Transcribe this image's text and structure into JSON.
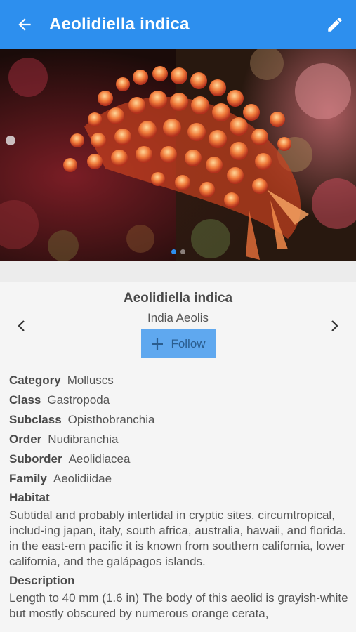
{
  "appbar": {
    "title": "Aeolidiella indica",
    "back_icon": "arrow-left-icon",
    "edit_icon": "pencil-icon",
    "color": "#2d8fee"
  },
  "gallery": {
    "image_label": "sea-slug-photo",
    "dots": 2,
    "active_dot": 0
  },
  "species": {
    "scientific_name": "Aeolidiella indica",
    "common_name": "India Aeolis",
    "follow_label": "Follow",
    "follow_icon": "plus-icon",
    "prev_icon": "chevron-left-icon",
    "next_icon": "chevron-right-icon"
  },
  "taxonomy": [
    {
      "key": "Category",
      "value": "Molluscs"
    },
    {
      "key": "Class",
      "value": "Gastropoda"
    },
    {
      "key": "Subclass",
      "value": "Opisthobranchia"
    },
    {
      "key": "Order",
      "value": "Nudibranchia"
    },
    {
      "key": "Suborder",
      "value": "Aeolidiacea"
    },
    {
      "key": "Family",
      "value": "Aeolidiidae"
    }
  ],
  "habitat": {
    "label": "Habitat",
    "text": "Subtidal and probably intertidal in cryptic sites. circumtropical, includ-ing japan, italy, south africa, australia, hawaii, and florida. in the east-ern pacific it is known from southern california, lower california, and the galápagos islands."
  },
  "description": {
    "label": "Description",
    "text": "Length to 40 mm (1.6 in) The body of this aeolid is grayish-white but mostly obscured by numerous orange cerata,"
  }
}
